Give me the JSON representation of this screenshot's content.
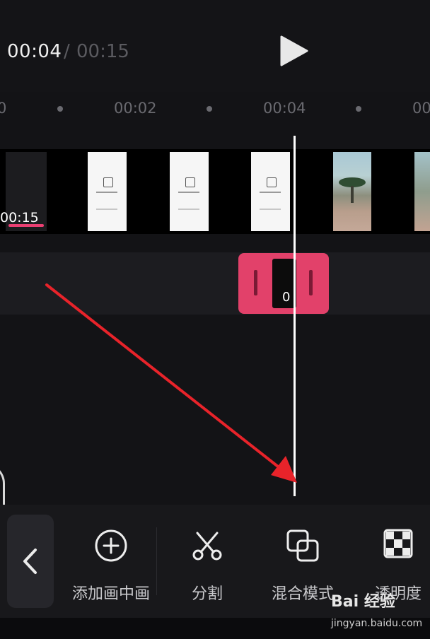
{
  "player": {
    "current_time": "00:04",
    "separator": "/",
    "total_time": "00:15",
    "play_icon": "play-icon"
  },
  "ruler": {
    "labels": [
      "0",
      "00:02",
      "00:04",
      "00"
    ]
  },
  "video_track": {
    "clip_duration": "00:15"
  },
  "pip_track": {
    "clip_label": "0"
  },
  "toolbar": {
    "back_icon": "chevron-left-icon",
    "items": [
      {
        "label": "添加画中画",
        "icon": "plus-circle-icon"
      },
      {
        "label": "分割",
        "icon": "scissors-icon"
      },
      {
        "label": "混合模式",
        "icon": "blend-mode-icon"
      },
      {
        "label": "透明度",
        "icon": "checkerboard-icon"
      }
    ]
  },
  "watermark": {
    "logo": "Bai 经验",
    "url": "jingyan.baidu.com"
  },
  "colors": {
    "accent": "#e2416a",
    "background": "#131316",
    "annotation_arrow": "#e8232a"
  }
}
